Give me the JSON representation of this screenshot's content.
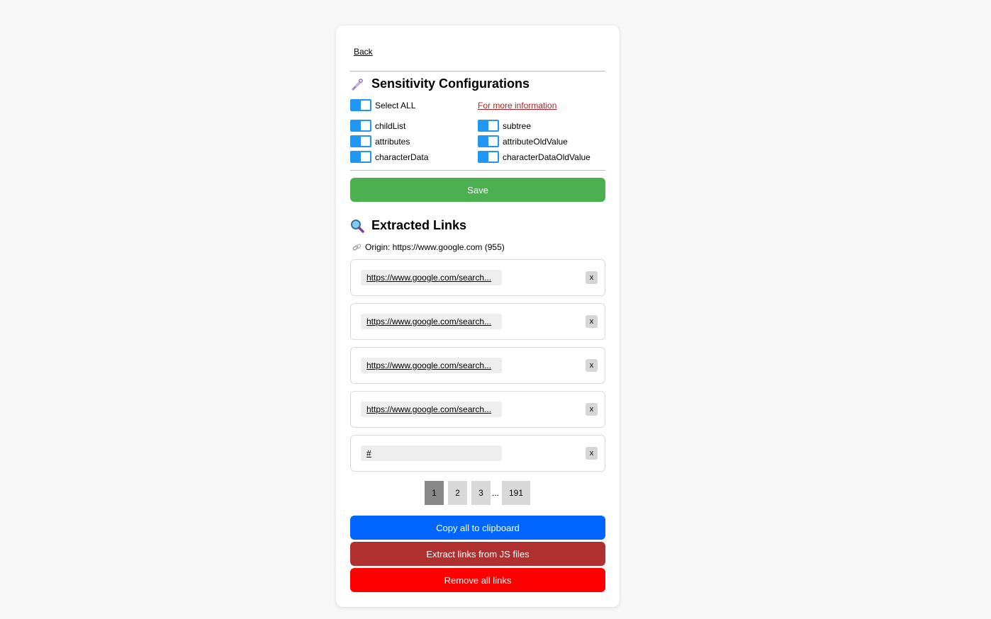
{
  "nav": {
    "back_label": "Back"
  },
  "sensitivity": {
    "title": "Sensitivity Configurations",
    "icon": "dropper-icon",
    "select_all_label": "Select ALL",
    "info_link_label": "For more information",
    "options": [
      {
        "label": "childList",
        "checked": true
      },
      {
        "label": "subtree",
        "checked": true
      },
      {
        "label": "attributes",
        "checked": true
      },
      {
        "label": "attributeOldValue",
        "checked": true
      },
      {
        "label": "characterData",
        "checked": true
      },
      {
        "label": "characterDataOldValue",
        "checked": true
      }
    ],
    "save_label": "Save",
    "save_color": "#4caf50",
    "toggle_color": "#2196f3"
  },
  "extracted": {
    "title": "Extracted Links",
    "icon": "magnifier-icon",
    "origin_text": "Origin: https://www.google.com (955)",
    "links": [
      {
        "url": "https://www.google.com/search...",
        "remove_label": "x"
      },
      {
        "url": "https://www.google.com/search...",
        "remove_label": "x"
      },
      {
        "url": "https://www.google.com/search...",
        "remove_label": "x"
      },
      {
        "url": "https://www.google.com/search...",
        "remove_label": "x"
      },
      {
        "url": "#",
        "remove_label": "x"
      }
    ],
    "pagination": {
      "pages": [
        "1",
        "2",
        "3"
      ],
      "ellipsis": "...",
      "last": "191",
      "current": "1"
    }
  },
  "actions": {
    "copy_label": "Copy all to clipboard",
    "copy_color": "#0066ff",
    "extract_js_label": "Extract links from JS files",
    "extract_js_color": "#b03030",
    "remove_all_label": "Remove all links",
    "remove_all_color": "#ff0000"
  }
}
